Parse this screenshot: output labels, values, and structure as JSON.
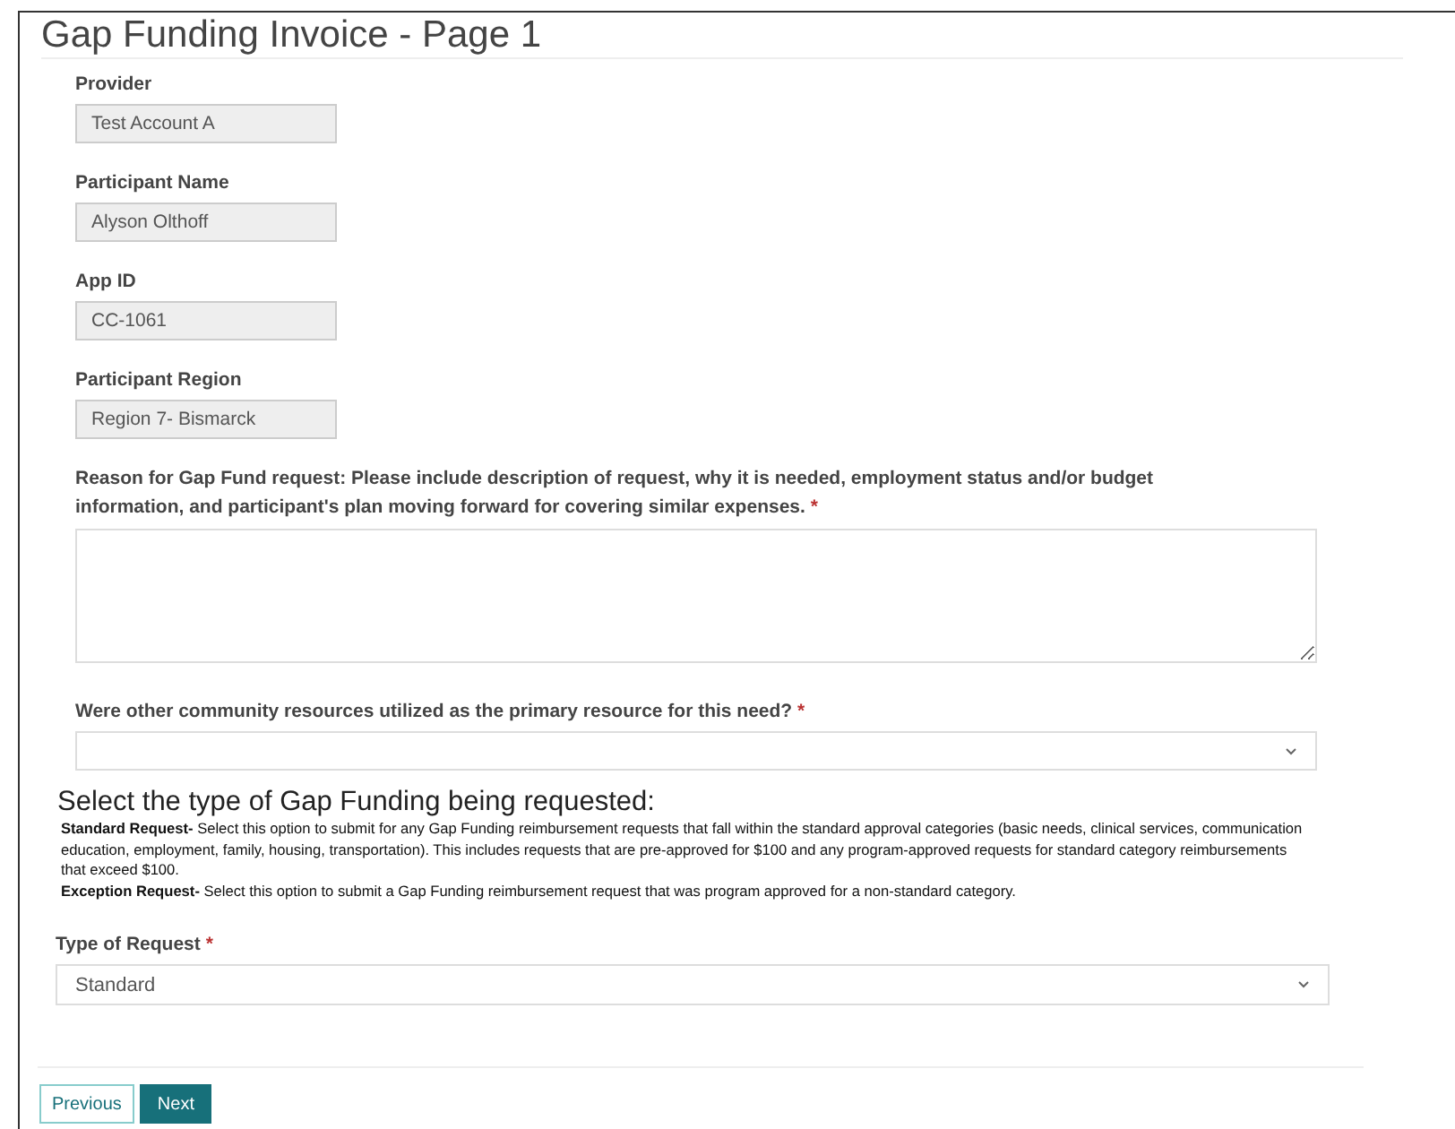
{
  "title": "Gap Funding Invoice - Page 1",
  "readonly_fields": [
    {
      "label": "Provider",
      "value": "Test Account A"
    },
    {
      "label": "Participant Name",
      "value": "Alyson Olthoff"
    },
    {
      "label": "App ID",
      "value": "CC-1061"
    },
    {
      "label": "Participant Region",
      "value": "Region 7- Bismarck"
    }
  ],
  "reason": {
    "label": "Reason for Gap Fund request: Please include description of request, why it is needed, employment status and/or budget information, and participant's plan moving forward for covering similar expenses.",
    "required_mark": "*"
  },
  "community_resources": {
    "label": "Were other community resources utilized as the primary resource for this need?",
    "required_mark": "*"
  },
  "section": {
    "heading": "Select the type of Gap Funding being requested:",
    "paragraphs": [
      "**Standard Request-** Select this option to submit for any Gap Funding reimbursement requests that fall within the standard approval categories (basic needs, clinical services, communication",
      "education, employment, family, housing, transportation). This includes requests that are pre-approved for $100 and any program-approved requests for standard category reimbursements",
      "that exceed $100.",
      "**Exception Request-** Select this option to submit a Gap Funding reimbursement request that was program approved for a non-standard category."
    ]
  },
  "type_of_request": {
    "label": "Type of Request",
    "required_mark": "*",
    "value": "Standard"
  },
  "buttons": [
    {
      "label": "Previous",
      "kind": "outline"
    },
    {
      "label": "Next",
      "kind": "primary"
    }
  ]
}
